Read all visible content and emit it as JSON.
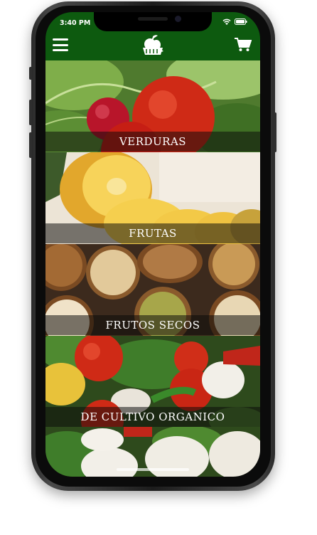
{
  "status_bar": {
    "time": "3:40 PM"
  },
  "header": {
    "menu_icon": "hamburger-menu-icon",
    "logo_icon": "fruit-basket-logo-icon",
    "cart_icon": "shopping-cart-icon"
  },
  "categories": [
    {
      "label": "VERDURAS",
      "image": "vegetables-photo"
    },
    {
      "label": "FRUTAS",
      "image": "pineapple-photo"
    },
    {
      "label": "FRUTOS SECOS",
      "image": "nuts-photo"
    },
    {
      "label": "DE CULTIVO ORGANICO",
      "image": "organic-produce-photo"
    }
  ],
  "colors": {
    "brand_green": "#0d5a0f",
    "banner_overlay": "rgba(10,10,10,0.52)"
  }
}
